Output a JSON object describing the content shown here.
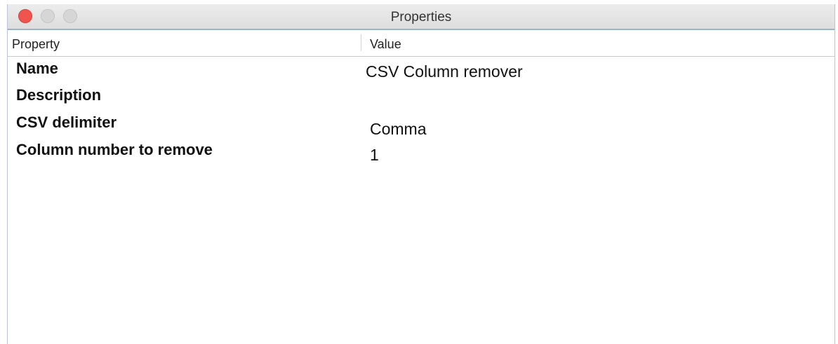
{
  "window": {
    "title": "Properties"
  },
  "table": {
    "headers": {
      "property": "Property",
      "value": "Value"
    },
    "rows": [
      {
        "property": "Name",
        "value": "CSV Column remover"
      },
      {
        "property": "Description",
        "value": ""
      },
      {
        "property": "CSV delimiter",
        "value": "Comma"
      },
      {
        "property": "Column number to remove",
        "value": "1"
      }
    ]
  },
  "colors": {
    "close_button": "#f0544c",
    "inactive_button": "#d6d6d6",
    "titlebar_border": "#9bb3cf"
  }
}
